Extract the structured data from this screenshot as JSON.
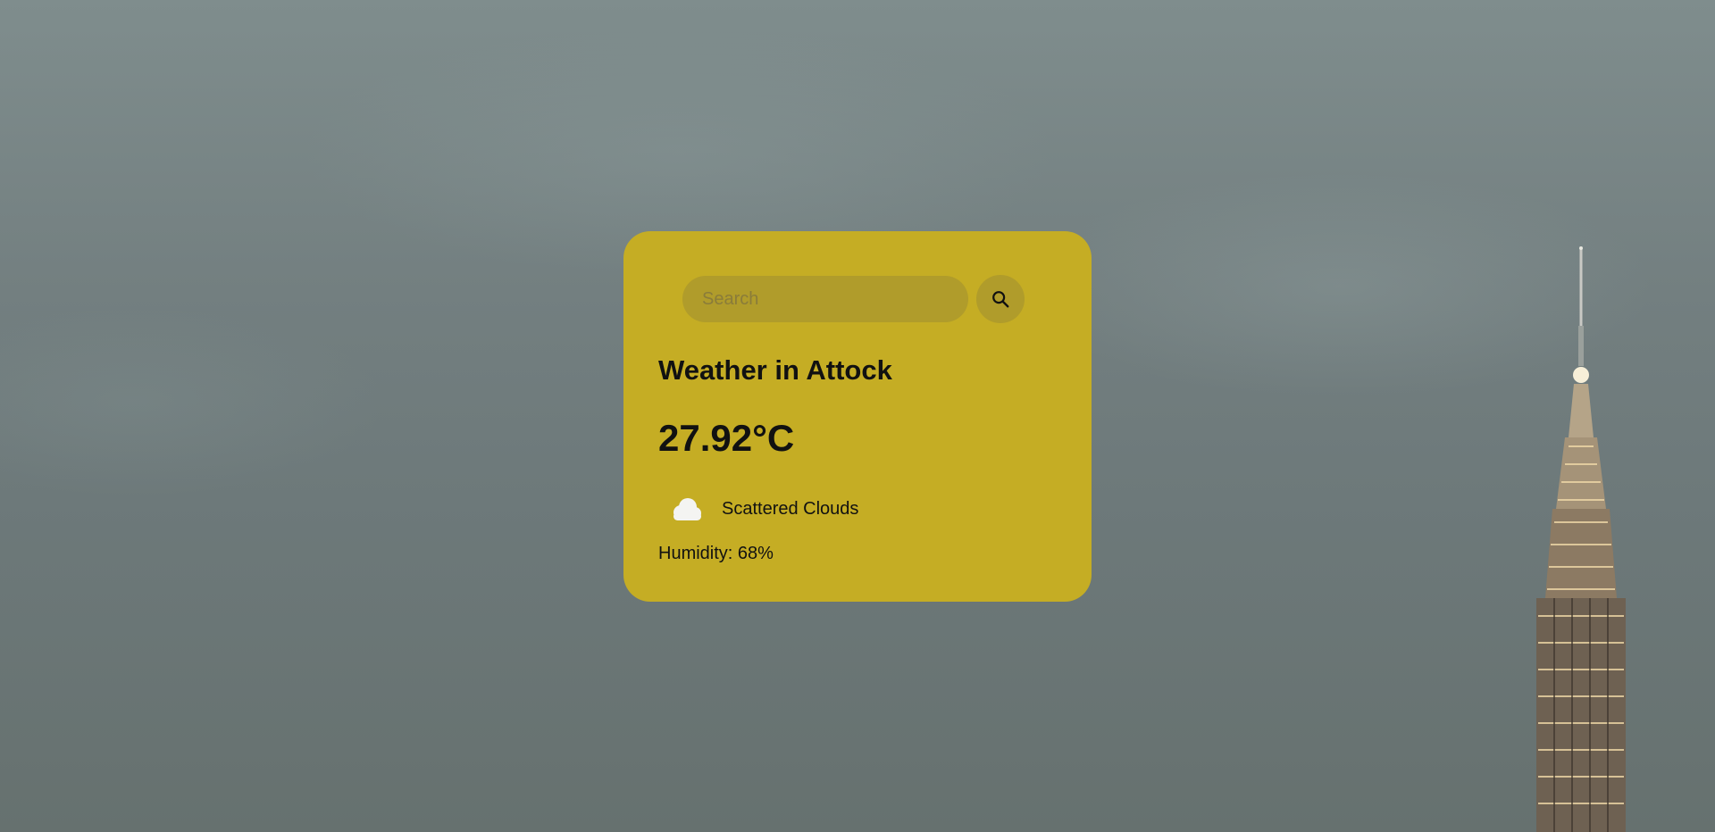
{
  "search": {
    "placeholder": "Search",
    "value": ""
  },
  "weather": {
    "title": "Weather in Attock",
    "temperature": "27.92°C",
    "description": "Scattered Clouds",
    "humidity": "Humidity: 68%",
    "icon": "cloud-icon"
  },
  "colors": {
    "card": "#c5ad24",
    "text": "#111111"
  }
}
